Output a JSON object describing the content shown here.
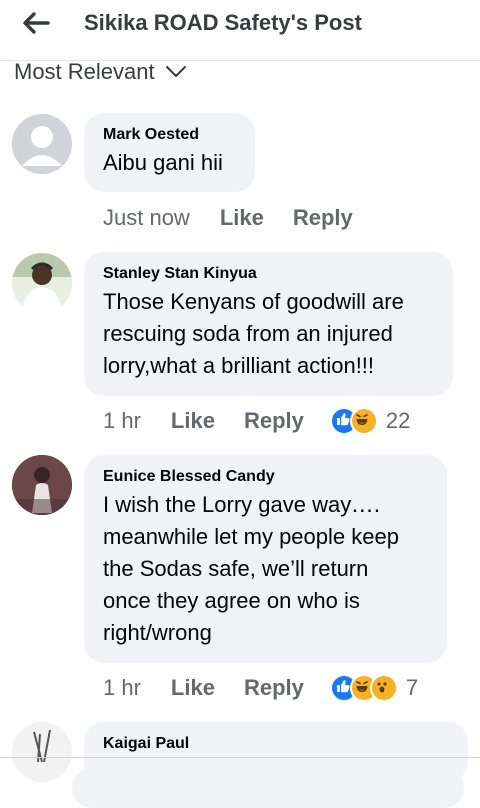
{
  "header": {
    "title": "Sikika ROAD Safety's Post"
  },
  "sort": {
    "label": "Most Relevant"
  },
  "actions": {
    "like": "Like",
    "reply": "Reply"
  },
  "comments": [
    {
      "author": "Mark Oested",
      "lines": [
        "Aibu gani hii"
      ],
      "time": "Just now",
      "reaction_count": ""
    },
    {
      "author": "Stanley Stan Kinyua",
      "lines": [
        "Those Kenyans of goodwill are",
        "rescuing soda from an injured",
        "lorry,what a brilliant action!!!"
      ],
      "time": "1 hr",
      "reaction_count": "22",
      "reactions": [
        "like-icon",
        "haha-icon"
      ]
    },
    {
      "author": "Eunice Blessed Candy",
      "lines": [
        "I wish the Lorry gave way․․․․",
        "meanwhile let my people keep",
        "the Sodas safe, we’ll return",
        "once they agree on who is",
        "right/wrong"
      ],
      "time": "1 hr",
      "reaction_count": "7",
      "reactions": [
        "like-icon",
        "haha-icon",
        "wow-icon"
      ]
    },
    {
      "author": "Kaigai Paul",
      "lines": [],
      "time": "",
      "reaction_count": ""
    }
  ],
  "colors": {
    "bubble": "#f0f2f5",
    "secondary_text": "#65676b",
    "like_blue": "#1877f2",
    "reaction_yellow": "#f7b125"
  }
}
